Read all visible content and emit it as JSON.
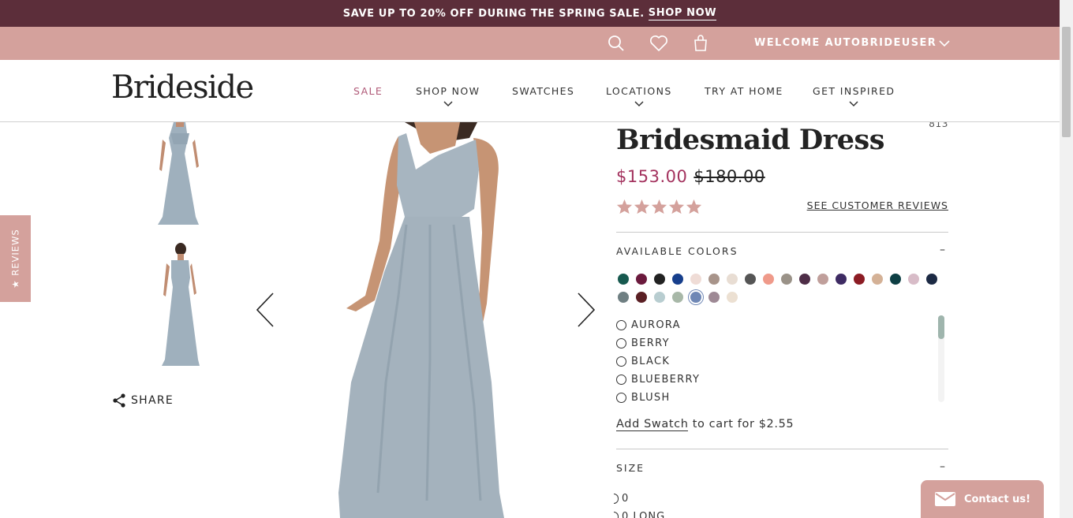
{
  "promo": {
    "text": "SAVE UP TO 20% OFF DURING THE SPRING SALE.",
    "link": "SHOP NOW"
  },
  "utility": {
    "welcome": "WELCOME AUTOBRIDEUSER"
  },
  "brand": {
    "logo": "Brideside"
  },
  "nav": {
    "sale": "SALE",
    "shop_now": "SHOP NOW",
    "swatches": "SWATCHES",
    "locations": "LOCATIONS",
    "try_at_home": "TRY AT HOME",
    "get_inspired": "GET INSPIRED"
  },
  "reviews_tab": "★ REVIEWS",
  "share_label": "SHARE",
  "product": {
    "title": "Bridesmaid Dress",
    "sku": "813",
    "price_sale": "$153.00",
    "price_original": "$180.00",
    "rating": 5,
    "see_reviews": "SEE CUSTOMER REVIEWS"
  },
  "colors_section": {
    "heading": "AVAILABLE COLORS",
    "toggle": "–",
    "swatches": [
      "#17594f",
      "#6b1a3d",
      "#222222",
      "#173f8c",
      "#efdcd6",
      "#a8948a",
      "#e8ddd3",
      "#555555",
      "#ef9a8a",
      "#9a9288",
      "#4e2d47",
      "#c09f9b",
      "#3e2b63",
      "#8c1c24",
      "#d4b196",
      "#0e3f44",
      "#d8bcc8",
      "#1c2a44",
      "#6f7f82",
      "#5a1f24",
      "#b8cdd0",
      "#a8b8a8",
      "#6f87b5",
      "#9e8995",
      "#ece0d2"
    ],
    "selected_index": 22,
    "options": [
      "AURORA",
      "BERRY",
      "BLACK",
      "BLUEBERRY",
      "BLUSH"
    ],
    "add_swatch_link": "Add Swatch",
    "add_swatch_text": "to cart for $2.55"
  },
  "size_section": {
    "heading": "SIZE",
    "toggle": "–",
    "options": [
      "0",
      "0 LONG"
    ]
  },
  "contact": {
    "label": "Contact us!"
  }
}
